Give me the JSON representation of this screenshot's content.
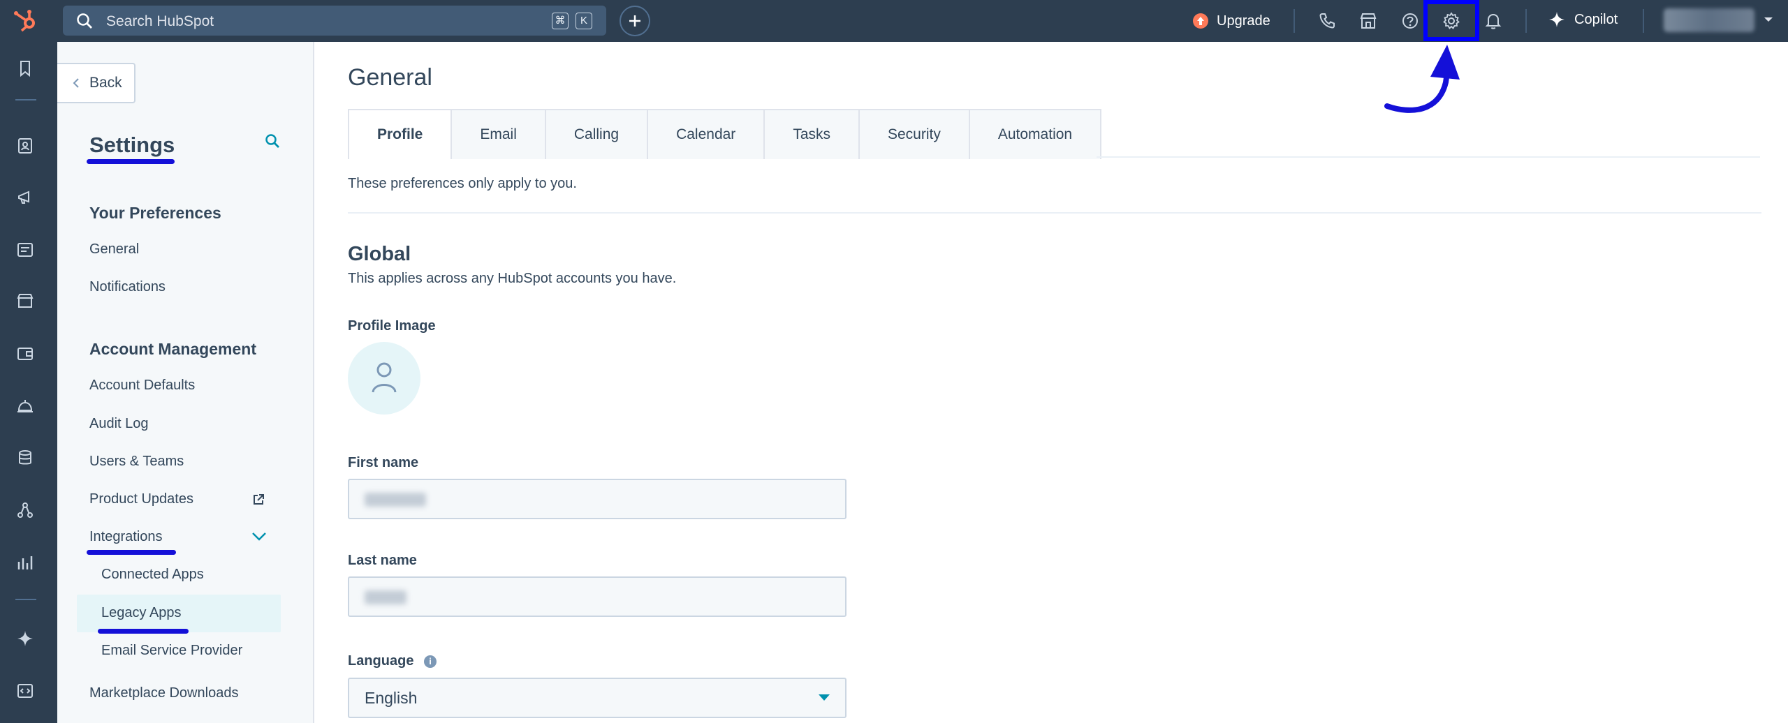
{
  "topbar": {
    "search_placeholder": "Search HubSpot",
    "shortcut_keys": [
      "⌘",
      "K"
    ],
    "upgrade_label": "Upgrade",
    "copilot_label": "Copilot"
  },
  "sidebar": {
    "back_label": "Back",
    "title": "Settings",
    "sections": [
      {
        "heading": "Your Preferences",
        "items": [
          "General",
          "Notifications"
        ]
      },
      {
        "heading": "Account Management",
        "items": [
          "Account Defaults",
          "Audit Log",
          "Users & Teams",
          "Product Updates",
          "Integrations"
        ]
      }
    ],
    "integrations_subitems": [
      "Connected Apps",
      "Legacy Apps",
      "Email Service Provider"
    ],
    "after_item": "Marketplace Downloads"
  },
  "main": {
    "title": "General",
    "tabs": [
      "Profile",
      "Email",
      "Calling",
      "Calendar",
      "Tasks",
      "Security",
      "Automation"
    ],
    "active_tab": "Profile",
    "preferences_note": "These preferences only apply to you.",
    "global_title": "Global",
    "global_subtitle": "This applies across any HubSpot accounts you have.",
    "profile_image_label": "Profile Image",
    "first_name_label": "First name",
    "last_name_label": "Last name",
    "language_label": "Language",
    "language_value": "English"
  },
  "colors": {
    "topbar": "#2d3e50",
    "accent": "#0091ae",
    "annotation": "#0000ff",
    "upgrade": "#ff7a59"
  }
}
